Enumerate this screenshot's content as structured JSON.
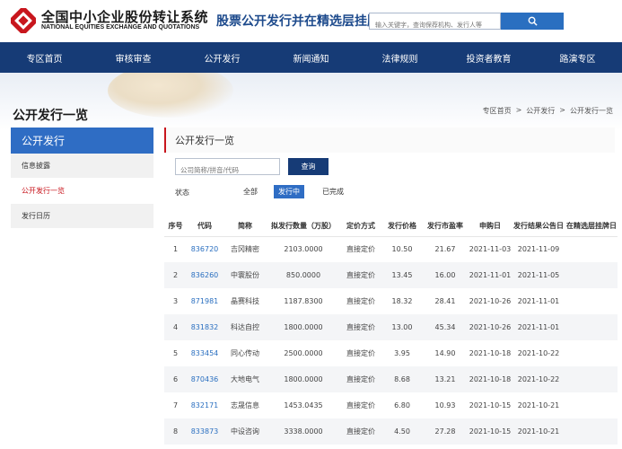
{
  "header": {
    "logo_cn": "全国中小企业股份转让系统",
    "logo_en": "NATIONAL EQUITIES EXCHANGE AND QUOTATIONS",
    "site_title": "股票公开发行并在精选层挂牌",
    "search_placeholder": "输入关键字，查询保荐机构、发行人等",
    "search_icon": "search-icon",
    "brand_color": "#c8161d",
    "nav_color": "#163b76"
  },
  "nav": [
    "专区首页",
    "审核审查",
    "公开发行",
    "新闻通知",
    "法律规则",
    "投资者教育",
    "路演专区"
  ],
  "page_heading": "公开发行一览",
  "breadcrumb": [
    "专区首页",
    ">",
    "公开发行",
    ">",
    "公开发行一览"
  ],
  "sidebar": {
    "title": "公开发行",
    "items": [
      {
        "label": "信息披露",
        "active": false
      },
      {
        "label": "公开发行一览",
        "active": true
      },
      {
        "label": "发行日历",
        "active": false
      }
    ]
  },
  "main": {
    "title": "公开发行一览",
    "filter_placeholder": "公司简称/拼音/代码",
    "query_label": "查询",
    "status_label": "状态",
    "status_options": [
      {
        "label": "全部",
        "active": false
      },
      {
        "label": "发行中",
        "active": true
      },
      {
        "label": "已完成",
        "active": false
      }
    ]
  },
  "table": {
    "headers": [
      "序号",
      "代码",
      "简称",
      "拟发行数量（万股）",
      "定价方式",
      "发行价格",
      "发行市盈率",
      "申购日",
      "发行结果公告日",
      "在精选层挂牌日"
    ],
    "rows": [
      [
        "1",
        "836720",
        "吉冈精密",
        "2103.0000",
        "直接定价",
        "10.50",
        "21.67",
        "2021-11-03",
        "2021-11-09",
        ""
      ],
      [
        "2",
        "836260",
        "中寰股份",
        "850.0000",
        "直接定价",
        "13.45",
        "16.00",
        "2021-11-01",
        "2021-11-05",
        ""
      ],
      [
        "3",
        "871981",
        "晶赛科技",
        "1187.8300",
        "直接定价",
        "18.32",
        "28.41",
        "2021-10-26",
        "2021-11-01",
        ""
      ],
      [
        "4",
        "831832",
        "科达自控",
        "1800.0000",
        "直接定价",
        "13.00",
        "45.34",
        "2021-10-26",
        "2021-11-01",
        ""
      ],
      [
        "5",
        "833454",
        "同心传动",
        "2500.0000",
        "直接定价",
        "3.95",
        "14.90",
        "2021-10-18",
        "2021-10-22",
        ""
      ],
      [
        "6",
        "870436",
        "大地电气",
        "1800.0000",
        "直接定价",
        "8.68",
        "13.21",
        "2021-10-18",
        "2021-10-22",
        ""
      ],
      [
        "7",
        "832171",
        "志晟信息",
        "1453.0435",
        "直接定价",
        "6.80",
        "10.93",
        "2021-10-15",
        "2021-10-21",
        ""
      ],
      [
        "8",
        "833873",
        "中设咨询",
        "3338.0000",
        "直接定价",
        "4.50",
        "27.28",
        "2021-10-15",
        "2021-10-21",
        ""
      ]
    ]
  }
}
